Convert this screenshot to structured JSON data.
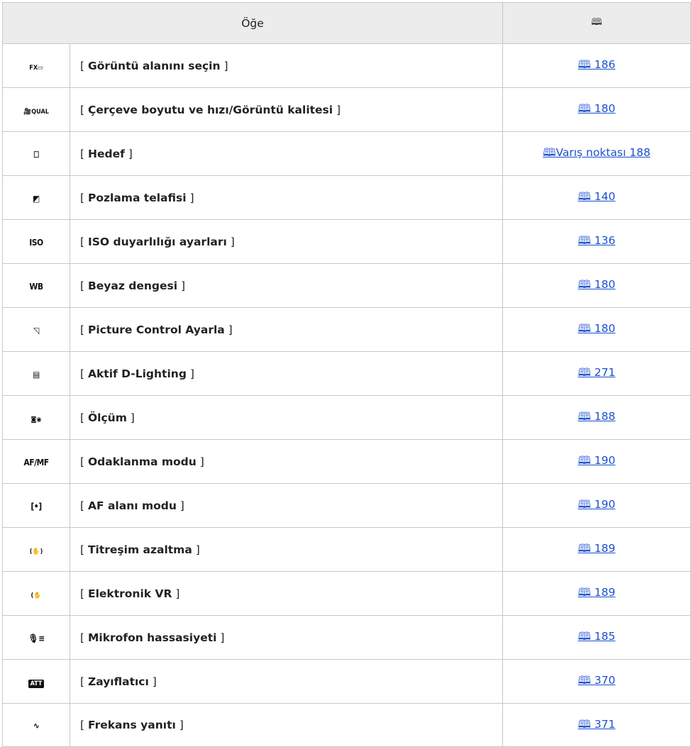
{
  "header": {
    "item_col": "Öğe",
    "page_col": "🕮"
  },
  "rows": [
    {
      "icon": "image-area-icon",
      "glyph": "FX▭",
      "name": "Görüntü alanını seçin",
      "page": "🕮 186"
    },
    {
      "icon": "movie-quality-icon",
      "glyph": "🎥QUAL",
      "name": "Çerçeve boyutu ve hızı/Görüntü kalitesi",
      "page": "🕮 180"
    },
    {
      "icon": "memory-card-icon",
      "glyph": "⎕",
      "name": "Hedef",
      "page": "🕮Varış noktası 188"
    },
    {
      "icon": "exposure-compensation-icon",
      "glyph": "◩",
      "name": "Pozlama telafisi",
      "page": "🕮 140"
    },
    {
      "icon": "iso-icon",
      "glyph": "ISO",
      "name": "ISO duyarlılığı ayarları",
      "page": "🕮 136"
    },
    {
      "icon": "white-balance-icon",
      "glyph": "WB",
      "name": "Beyaz dengesi",
      "page": "🕮 180"
    },
    {
      "icon": "picture-control-icon",
      "glyph": "◹",
      "name": "Picture Control Ayarla",
      "page": "🕮 180"
    },
    {
      "icon": "active-d-lighting-icon",
      "glyph": "▤",
      "name": "Aktif D-Lighting",
      "page": "🕮 271"
    },
    {
      "icon": "metering-icon",
      "glyph": "◙◉",
      "name": "Ölçüm",
      "page": "🕮 188"
    },
    {
      "icon": "af-mf-icon",
      "glyph": "AF/MF",
      "name": "Odaklanma modu",
      "page": "🕮 190"
    },
    {
      "icon": "af-area-icon",
      "glyph": "[•]",
      "name": "AF alanı modu",
      "page": "🕮 190"
    },
    {
      "icon": "vibration-reduction-icon",
      "glyph": "(✋)",
      "name": "Titreşim azaltma",
      "page": "🕮 189"
    },
    {
      "icon": "electronic-vr-icon",
      "glyph": "(✋",
      "name": "Elektronik VR",
      "page": "🕮 189"
    },
    {
      "icon": "microphone-sensitivity-icon",
      "glyph": "🎙≡",
      "name": "Mikrofon hassasiyeti",
      "page": "🕮 185"
    },
    {
      "icon": "attenuator-icon",
      "glyph": "ATT",
      "name": "Zayıflatıcı",
      "page": "🕮 370"
    },
    {
      "icon": "frequency-response-icon",
      "glyph": "∿",
      "name": "Frekans yanıtı",
      "page": "🕮 371"
    }
  ]
}
